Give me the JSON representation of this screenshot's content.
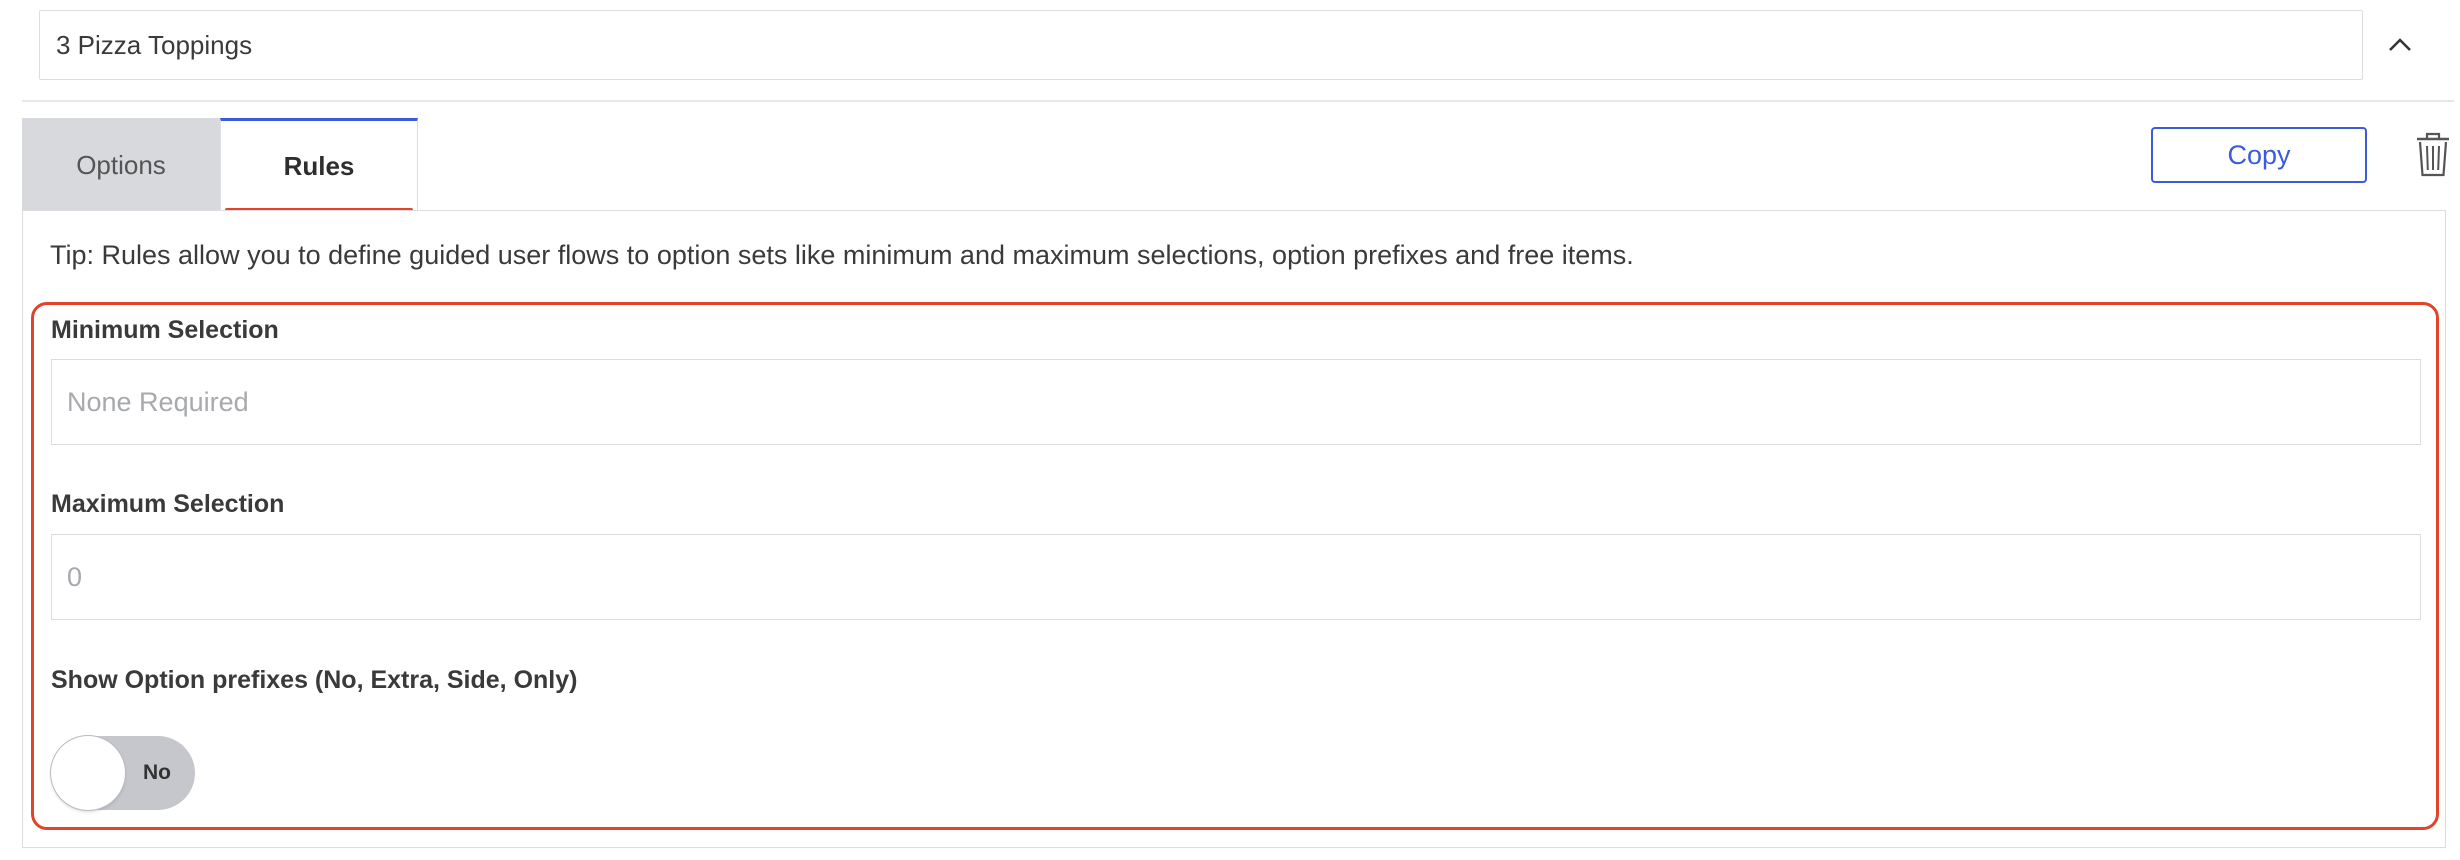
{
  "option_set": {
    "name_value": "3 Pizza Toppings",
    "collapse_icon": "chevron-up-icon"
  },
  "tabs": [
    {
      "label": "Options",
      "active": false
    },
    {
      "label": "Rules",
      "active": true
    }
  ],
  "actions": {
    "copy_label": "Copy",
    "delete_icon": "trash-icon"
  },
  "rules": {
    "tip": "Tip: Rules allow you to define guided user flows to option sets like minimum and maximum selections, option prefixes and free items.",
    "min_selection": {
      "label": "Minimum Selection",
      "placeholder": "None Required",
      "value": ""
    },
    "max_selection": {
      "label": "Maximum Selection",
      "placeholder": "0",
      "value": ""
    },
    "prefixes": {
      "label": "Show Option prefixes (No, Extra, Side, Only)",
      "toggle_text": "No",
      "enabled": false
    }
  },
  "colors": {
    "accent_blue": "#3b5bdb",
    "highlight_red": "#e0452c",
    "tab_inactive_bg": "#d8d9dd",
    "toggle_off_bg": "#c5c7cc"
  }
}
